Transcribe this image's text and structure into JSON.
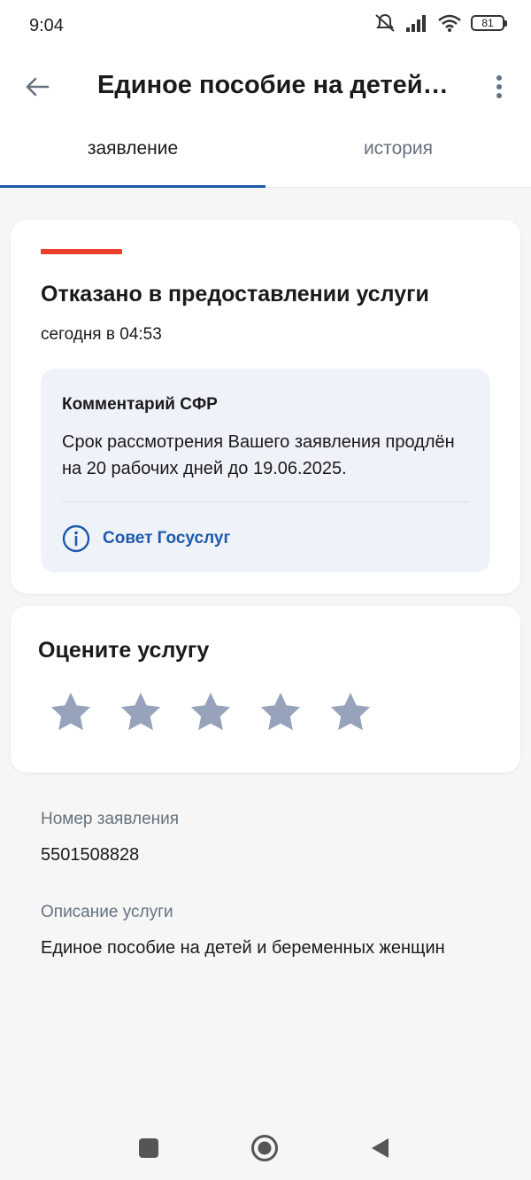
{
  "status_bar": {
    "time": "9:04",
    "battery": "81",
    "icons": [
      "mute-icon",
      "signal-icon",
      "wifi-icon",
      "battery-icon"
    ]
  },
  "header": {
    "title": "Единое пособие на детей и беременных женщин",
    "back_icon": "back-arrow-icon",
    "menu_icon": "more-vert-icon"
  },
  "tabs": [
    {
      "label": "заявление",
      "active": true
    },
    {
      "label": "история",
      "active": false
    }
  ],
  "status_card": {
    "accent_color": "#ee3f2e",
    "title": "Отказано в предоставлении услуги",
    "date": "сегодня в 04:53",
    "comment": {
      "title": "Комментарий СФР",
      "text": "Срок рассмотрения Вашего заявления продлён на 20 рабочих дней до 19.06.2025.",
      "advice_label": "Совет Госуслуг",
      "advice_icon": "info-icon"
    }
  },
  "rating_card": {
    "title": "Оцените услугу",
    "star_count": 5,
    "star_color": "#96a3bb"
  },
  "details": {
    "number_label": "Номер заявления",
    "number_value": "5501508828",
    "description_label": "Описание услуги",
    "description_value": "Единое пособие на детей и беременных женщин"
  },
  "colors": {
    "primary": "#1d5aab",
    "background": "#f6f6f6"
  }
}
